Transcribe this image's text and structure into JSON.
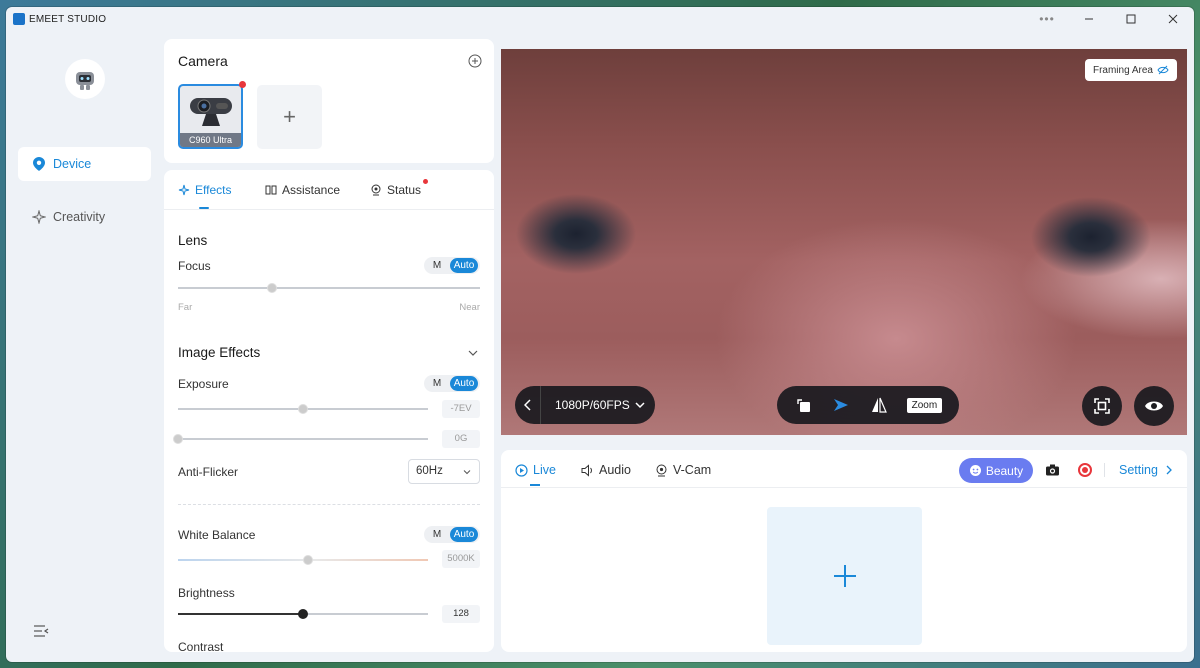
{
  "window": {
    "title": "EMEET STUDIO"
  },
  "nav": {
    "items": [
      {
        "label": "Device",
        "icon": "location-pin-icon",
        "active": true
      },
      {
        "label": "Creativity",
        "icon": "sparkle-icon",
        "active": false
      }
    ]
  },
  "camera": {
    "title": "Camera",
    "device_label": "C960 Ultra",
    "add_symbol": "+"
  },
  "tabs": {
    "effects": "Effects",
    "assistance": "Assistance",
    "status": "Status"
  },
  "lens": {
    "title": "Lens",
    "focus_label": "Focus",
    "focus_m": "M",
    "focus_auto": "Auto",
    "focus_level": 0.31,
    "far": "Far",
    "near": "Near"
  },
  "image_effects": {
    "title": "Image Effects",
    "exposure_label": "Exposure",
    "exposure_m": "M",
    "exposure_auto": "Auto",
    "exposure_value": "-7EV",
    "exposure_level": 0.5,
    "gain_value": "0G",
    "gain_level": 0,
    "antiflicker_label": "Anti-Flicker",
    "antiflicker_value": "60Hz",
    "white_balance_label": "White Balance",
    "wb_m": "M",
    "wb_auto": "Auto",
    "wb_value": "5000K",
    "wb_level": 0.52,
    "brightness_label": "Brightness",
    "brightness_value": "128",
    "brightness_level": 0.5,
    "contrast_label": "Contrast"
  },
  "preview": {
    "framing_label": "Framing Area",
    "resolution": "1080P/60FPS",
    "zoom_label": "Zoom"
  },
  "bottom": {
    "tabs": {
      "live": "Live",
      "audio": "Audio",
      "vcam": "V-Cam"
    },
    "beauty": "Beauty",
    "setting": "Setting"
  },
  "colors": {
    "accent": "#1a88d8",
    "beauty": "#6a7cf0",
    "record": "#e8363b"
  }
}
